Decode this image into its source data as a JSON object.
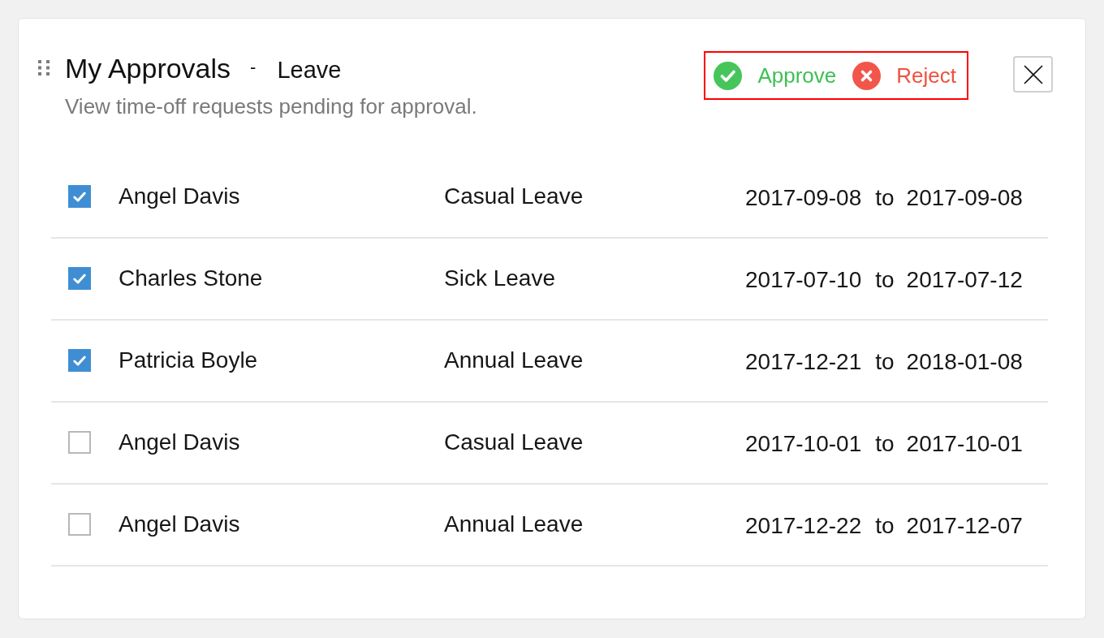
{
  "header": {
    "title": "My Approvals",
    "separator": "-",
    "module": "Leave",
    "description": "View time-off requests pending for approval."
  },
  "actions": [
    {
      "kind": "approve",
      "label": "Approve"
    },
    {
      "kind": "reject",
      "label": "Reject"
    }
  ],
  "rows": [
    {
      "checked": true,
      "name": "Angel Davis",
      "leave_type": "Casual Leave",
      "from": "2017-09-08",
      "connector": "to",
      "to": "2017-09-08"
    },
    {
      "checked": true,
      "name": "Charles Stone",
      "leave_type": "Sick Leave",
      "from": "2017-07-10",
      "connector": "to",
      "to": "2017-07-12"
    },
    {
      "checked": true,
      "name": "Patricia Boyle",
      "leave_type": "Annual Leave",
      "from": "2017-12-21",
      "connector": "to",
      "to": "2018-01-08"
    },
    {
      "checked": false,
      "name": "Angel Davis",
      "leave_type": "Casual Leave",
      "from": "2017-10-01",
      "connector": "to",
      "to": "2017-10-01"
    },
    {
      "checked": false,
      "name": "Angel Davis",
      "leave_type": "Annual Leave",
      "from": "2017-12-22",
      "connector": "to",
      "to": "2017-12-07"
    }
  ]
}
